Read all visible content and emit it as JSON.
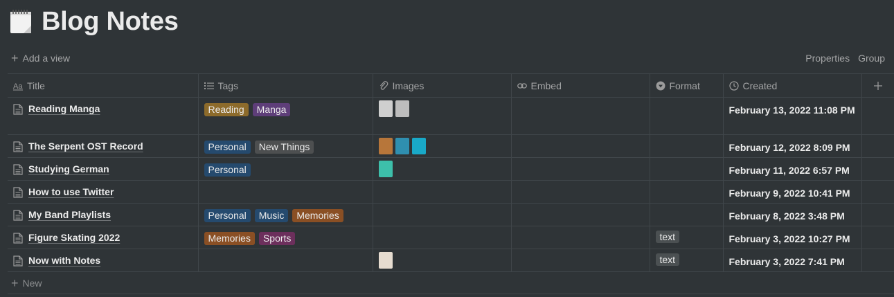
{
  "page": {
    "title": "Blog Notes",
    "icon": "notepad-icon"
  },
  "toolbar": {
    "add_view": "Add a view",
    "properties": "Properties",
    "group": "Group"
  },
  "columns": [
    {
      "label": "Title",
      "icon": "text-aa-icon"
    },
    {
      "label": "Tags",
      "icon": "list-icon"
    },
    {
      "label": "Images",
      "icon": "paperclip-icon"
    },
    {
      "label": "Embed",
      "icon": "link-icon"
    },
    {
      "label": "Format",
      "icon": "select-icon"
    },
    {
      "label": "Created",
      "icon": "clock-icon"
    }
  ],
  "add_column_icon": "plus-icon",
  "tag_colors": {
    "Reading": "#8d6b2b",
    "Manga": "#5e3e79",
    "Personal": "#254a6e",
    "New Things": "#4d4f50",
    "Music": "#254a6e",
    "Memories": "#8a4f24",
    "Sports": "#6c2f5c"
  },
  "rows": [
    {
      "title": "Reading Manga",
      "tags": [
        "Reading",
        "Manga"
      ],
      "images": [
        "#cfcfcf",
        "#bdbdbd"
      ],
      "format": "",
      "created": "February 13, 2022 11:08 PM"
    },
    {
      "title": "The Serpent OST Record",
      "tags": [
        "Personal",
        "New Things"
      ],
      "images": [
        "#b7763a",
        "#2f8fb0",
        "#19a9c8"
      ],
      "format": "",
      "created": "February 12, 2022 8:09 PM"
    },
    {
      "title": "Studying German",
      "tags": [
        "Personal"
      ],
      "images": [
        "#3dbfaa"
      ],
      "format": "",
      "created": "February 11, 2022 6:57 PM"
    },
    {
      "title": "How to use Twitter",
      "tags": [],
      "images": [],
      "format": "",
      "created": "February 9, 2022 10:41 PM"
    },
    {
      "title": "My Band Playlists",
      "tags": [
        "Personal",
        "Music",
        "Memories"
      ],
      "images": [],
      "format": "",
      "created": "February 8, 2022 3:48 PM"
    },
    {
      "title": "Figure Skating 2022",
      "tags": [
        "Memories",
        "Sports"
      ],
      "images": [],
      "format": "text",
      "created": "February 3, 2022 10:27 PM"
    },
    {
      "title": "Now with Notes",
      "tags": [],
      "images": [
        "#e6dcd0"
      ],
      "format": "text",
      "created": "February 3, 2022 7:41 PM"
    }
  ],
  "new_row_label": "New"
}
